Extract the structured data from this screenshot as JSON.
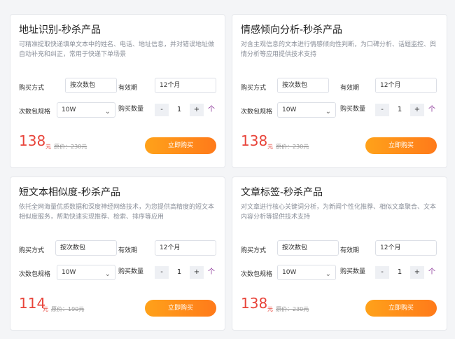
{
  "cards": [
    {
      "title": "地址识别-秒杀产品",
      "description": "可精准提取快递填单文本中的姓名、电话、地址信息，并对错误地址做自动补充和纠正，常用于快递下单场景",
      "buy_method_label": "购买方式",
      "buy_method_value": "按次数包",
      "validity_label": "有效期",
      "validity_value": "12个月",
      "spec_label": "次数包规格",
      "spec_value": "10W",
      "quantity_label": "购买数量",
      "quantity": "1",
      "unit": "个",
      "price": "138",
      "price_unit": "元",
      "original_price": "原价：230元",
      "buy_button": "立即购买"
    },
    {
      "title": "情感倾向分析-秒杀产品",
      "description": "对含主观信息的文本进行情感倾向性判断，为口碑分析、话题监控、舆情分析等应用提供技术支持",
      "buy_method_label": "购买方式",
      "buy_method_value": "按次数包",
      "validity_label": "有效期",
      "validity_value": "12个月",
      "spec_label": "次数包规格",
      "spec_value": "10W",
      "quantity_label": "购买数量",
      "quantity": "1",
      "unit": "个",
      "price": "138",
      "price_unit": "元",
      "original_price": "原价：230元",
      "buy_button": "立即购买"
    },
    {
      "title": "短文本相似度-秒杀产品",
      "description": "依托全网海量优质数据和深度神经网络技术，为您提供高精度的短文本相似度服务，帮助快速实现推荐、检索、排序等应用",
      "buy_method_label": "购买方式",
      "buy_method_value": "按次数包",
      "validity_label": "有效期",
      "validity_value": "12个月",
      "spec_label": "次数包规格",
      "spec_value": "10W",
      "quantity_label": "购买数量",
      "quantity": "1",
      "unit": "个",
      "price": "114",
      "price_unit": "元",
      "original_price": "原价：190元",
      "buy_button": "立即购买"
    },
    {
      "title": "文章标签-秒杀产品",
      "description": "对文章进行核心关键词分析，为新闻个性化推荐、相似文章聚合、文本内容分析等提供技术支持",
      "buy_method_label": "购买方式",
      "buy_method_value": "按次数包",
      "validity_label": "有效期",
      "validity_value": "12个月",
      "spec_label": "次数包规格",
      "spec_value": "10W",
      "quantity_label": "购买数量",
      "quantity": "1",
      "unit": "个",
      "price": "138",
      "price_unit": "元",
      "original_price": "原价：230元",
      "buy_button": "立即购买"
    }
  ],
  "controls": {
    "minus": "-",
    "plus": "+",
    "chevron": "⌄"
  },
  "colors": {
    "price": "#e8443a",
    "button_start": "#ffa21a",
    "button_end": "#ff7a1a"
  }
}
